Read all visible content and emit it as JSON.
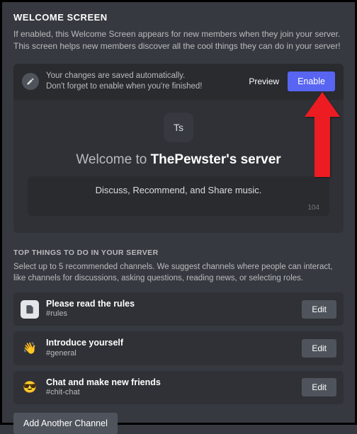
{
  "header": {
    "title": "WELCOME SCREEN",
    "subtitle": "If enabled, this Welcome Screen appears for new members when they join your server. This screen helps new members discover all the cool things they can do in your server!"
  },
  "savebar": {
    "line1": "Your changes are saved automatically.",
    "line2": "Don't forget to enable when you're finished!",
    "preview": "Preview",
    "enable": "Enable"
  },
  "welcome": {
    "avatar_initials": "Ts",
    "prefix": "Welcome to ",
    "server_name": "ThePewster's server",
    "description": "Discuss, Recommend, and Share music.",
    "char_remaining": "104"
  },
  "top_things": {
    "heading": "TOP THINGS TO DO IN YOUR SERVER",
    "desc": "Select up to 5 recommended channels. We suggest channels where people can interact, like channels for discussions, asking questions, reading news, or selecting roles.",
    "edit_label": "Edit",
    "items": [
      {
        "emoji": "",
        "title": "Please read the rules",
        "channel": "#rules"
      },
      {
        "emoji": "👋",
        "title": "Introduce yourself",
        "channel": "#general"
      },
      {
        "emoji": "😎",
        "title": "Chat and make new friends",
        "channel": "#chit-chat"
      }
    ],
    "add_label": "Add Another Channel"
  }
}
